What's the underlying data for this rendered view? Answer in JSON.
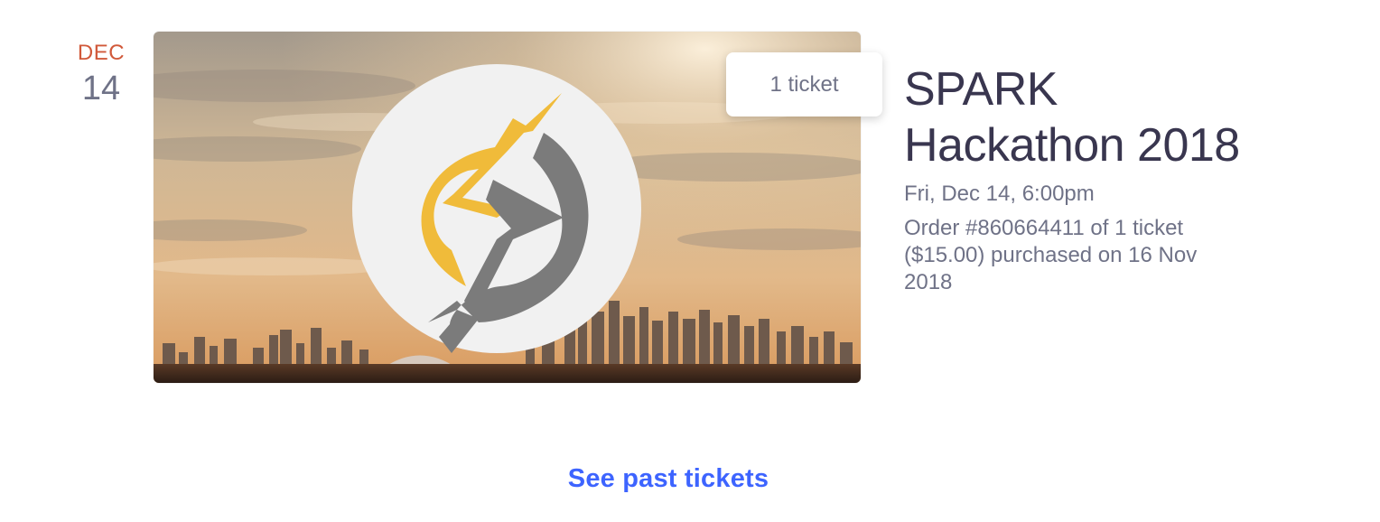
{
  "event": {
    "date": {
      "month": "DEC",
      "day": "14"
    },
    "ticket_badge": "1 ticket",
    "title": "SPARK Hackathon 2018",
    "datetime": "Fri, Dec 14, 6:00pm",
    "order": "Order #860664411 of 1 ticket ($15.00) purchased on 16 Nov 2018",
    "logo_colors": {
      "gold": "#f0bb3a",
      "gray": "#7b7b7b",
      "circle": "#f1f1f1"
    }
  },
  "footer": {
    "see_past_tickets": "See past tickets"
  },
  "colors": {
    "accent_link": "#3d64ff",
    "date_month": "#d1593a",
    "title": "#39364f",
    "muted": "#6f7287"
  }
}
